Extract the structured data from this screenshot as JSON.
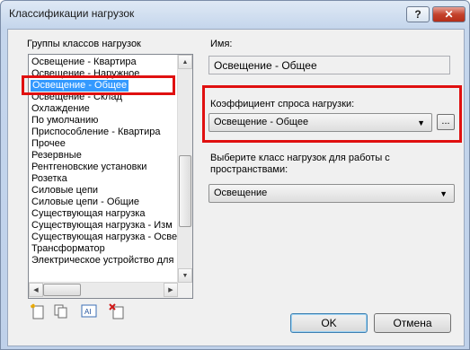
{
  "window": {
    "title": "Классификации нагрузок",
    "help_label": "?",
    "close_label": "✕"
  },
  "groups": {
    "label": "Группы классов нагрузок",
    "items": [
      "Освещение - Квартира",
      "Освещение - Наружное",
      "Освещение - Общее",
      "Освещение - Склад",
      "Охлаждение",
      "По умолчанию",
      "Приспособление - Квартира",
      "Прочее",
      "Резервные",
      "Рентгеновские установки",
      "Розетка",
      "Силовые цепи",
      "Силовые цепи - Общие",
      "Существующая нагрузка",
      "Существующая нагрузка - Изм",
      "Существующая нагрузка - Осве",
      "Трансформатор",
      "Электрическое устройство для"
    ],
    "selected_index": 2
  },
  "name_field": {
    "label": "Имя:",
    "value": "Освещение - Общее"
  },
  "demand_factor": {
    "label": "Коэффициент спроса нагрузки:",
    "value": "Освещение - Общее",
    "browse_label": "..."
  },
  "space_class": {
    "label_line1": "Выберите класс нагрузок для работы с",
    "label_line2": "пространствами:",
    "value": "Освещение"
  },
  "buttons": {
    "ok": "OK",
    "cancel": "Отмена"
  },
  "toolbar_icons": [
    "new-icon",
    "duplicate-icon",
    "rename-icon",
    "delete-icon"
  ],
  "colors": {
    "selection": "#3399ff",
    "highlight_box": "#e01010"
  }
}
